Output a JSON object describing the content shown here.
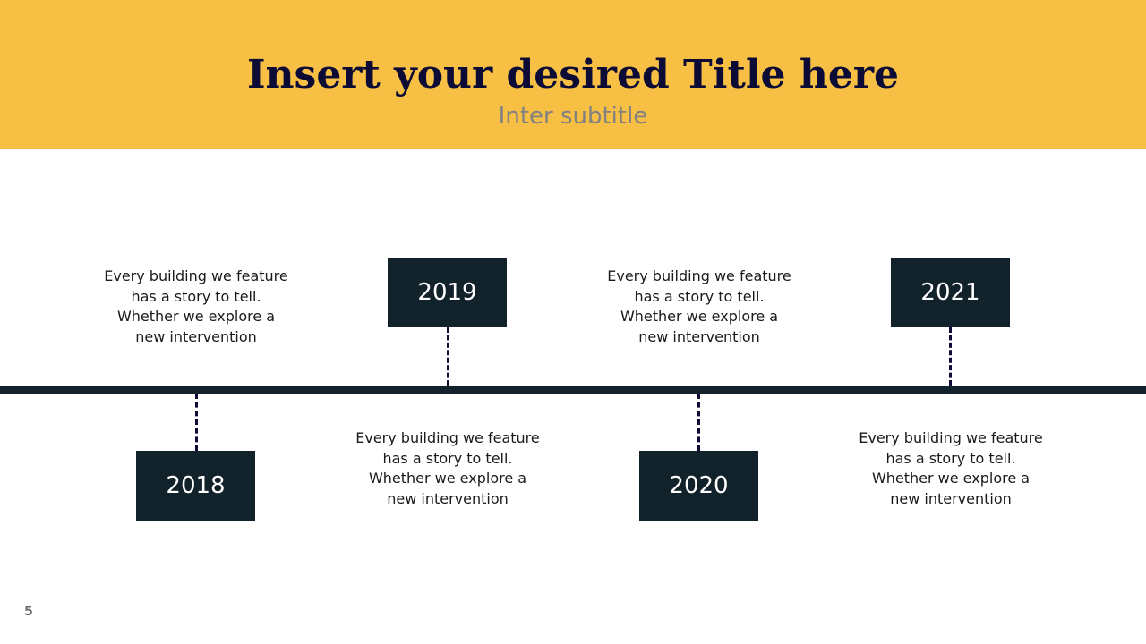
{
  "slide": {
    "title": "Insert your desired Title here",
    "subtitle": "Inter subtitle",
    "page_number": "5"
  },
  "colors": {
    "header_background": "#F7C045",
    "title_text": "#0C0B35",
    "subtitle_text": "#808080",
    "timeline_line": "#12222B",
    "year_box": "#12222B",
    "connector": "#0C0B35"
  },
  "timeline": {
    "milestones": [
      {
        "year": "2018",
        "description": [
          "Every building we feature",
          "has a story to tell.",
          "Whether we explore a",
          "new intervention"
        ]
      },
      {
        "year": "2019",
        "description": [
          "Every building we feature",
          "has a story to tell.",
          "Whether we explore a",
          "new intervention"
        ]
      },
      {
        "year": "2020",
        "description": [
          "Every building we feature",
          "has a story to tell.",
          "Whether we explore a",
          "new intervention"
        ]
      },
      {
        "year": "2021",
        "description": [
          "Every building we feature",
          "has a story to tell.",
          "Whether we explore a",
          "new intervention"
        ]
      }
    ]
  }
}
